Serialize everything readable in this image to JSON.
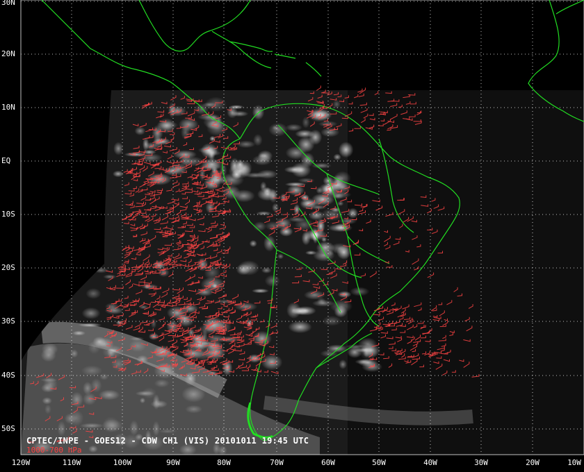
{
  "caption": "CPTEC/INPE - GOES12 - CDW CH1 (VIS) 20101011 19:45 UTC",
  "legend": "1000-700 hPa",
  "lat_labels": [
    "30N",
    "20N",
    "10N",
    "EQ",
    "10S",
    "20S",
    "30S",
    "40S",
    "50S"
  ],
  "lon_labels": [
    "120W",
    "110W",
    "100W",
    "90W",
    "80W",
    "70W",
    "60W",
    "50W",
    "40W",
    "30W",
    "20W",
    "10W"
  ],
  "colors": {
    "coastline": "#22dd22",
    "wind_vectors": "#ff4444",
    "grid": "#ffffff",
    "background": "#000000"
  }
}
